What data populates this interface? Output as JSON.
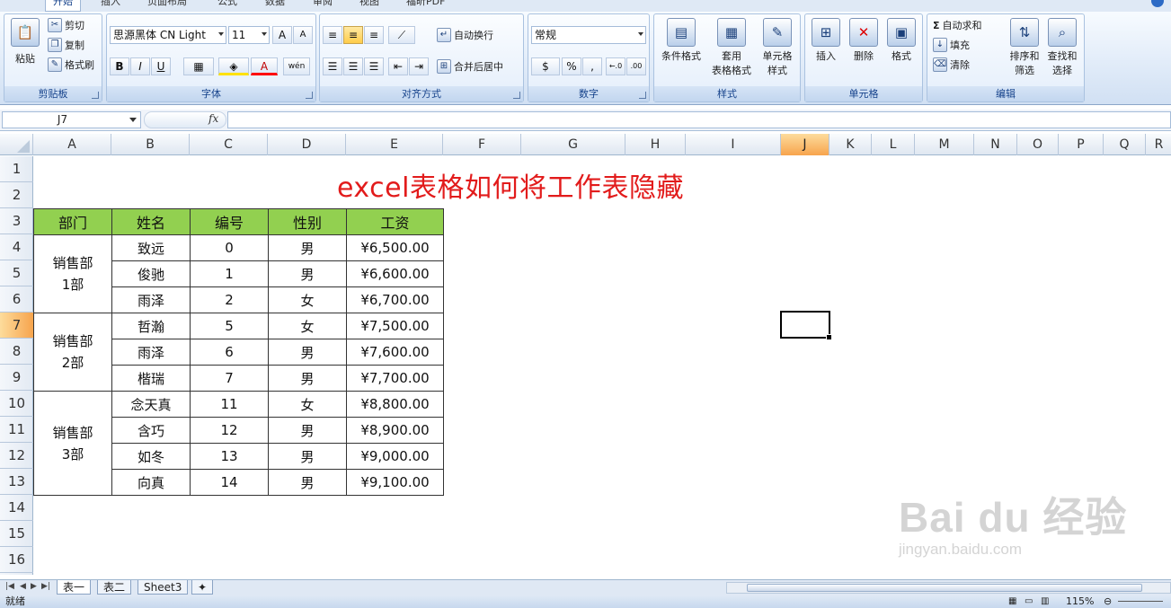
{
  "ribbon_tabs": [
    "开始",
    "插入",
    "页面布局",
    "公式",
    "数据",
    "审阅",
    "视图",
    "福昕PDF"
  ],
  "clipboard": {
    "paste": "粘贴",
    "cut": "剪切",
    "copy": "复制",
    "format_painter": "格式刷",
    "title": "剪贴板"
  },
  "font": {
    "name": "思源黑体 CN Light",
    "size": "11",
    "title": "字体",
    "bold": "B",
    "italic": "I",
    "underline": "U",
    "grow": "A",
    "shrink": "A",
    "phonetic": "wén"
  },
  "alignment": {
    "wrap": "自动换行",
    "merge": "合并后居中",
    "title": "对齐方式"
  },
  "number": {
    "format": "常规",
    "percent": "%",
    "comma": ",",
    "title": "数字",
    "inc": "←.0",
    "dec": ".00"
  },
  "styles": {
    "conditional": "条件格式",
    "table_format_1": "套用",
    "table_format_2": "表格格式",
    "cell_style_1": "单元格",
    "cell_style_2": "样式",
    "title": "样式"
  },
  "cells": {
    "insert": "插入",
    "delete": "删除",
    "format": "格式",
    "title": "单元格"
  },
  "editing": {
    "autosum": "自动求和",
    "fill": "填充",
    "clear": "清除",
    "sort_1": "排序和",
    "sort_2": "筛选",
    "find_1": "查找和",
    "find_2": "选择",
    "title": "编辑"
  },
  "namebox": "J7",
  "fx": "fx",
  "columns": [
    "A",
    "B",
    "C",
    "D",
    "E",
    "F",
    "G",
    "H",
    "I",
    "J",
    "K",
    "L",
    "M",
    "N",
    "O",
    "P",
    "Q",
    "R"
  ],
  "rows": [
    "1",
    "2",
    "3",
    "4",
    "5",
    "6",
    "7",
    "8",
    "9",
    "10",
    "11",
    "12",
    "13",
    "14",
    "15",
    "16"
  ],
  "sheet_title": "excel表格如何将工作表隐藏",
  "table": {
    "headers": [
      "部门",
      "姓名",
      "编号",
      "性别",
      "工资"
    ],
    "groups": [
      {
        "dept_1": "销售部",
        "dept_2": "1部",
        "rows": [
          [
            "致远",
            "0",
            "男",
            "¥6,500.00"
          ],
          [
            "俊驰",
            "1",
            "男",
            "¥6,600.00"
          ],
          [
            "雨泽",
            "2",
            "女",
            "¥6,700.00"
          ]
        ]
      },
      {
        "dept_1": "销售部",
        "dept_2": "2部",
        "rows": [
          [
            "哲瀚",
            "5",
            "女",
            "¥7,500.00"
          ],
          [
            "雨泽",
            "6",
            "男",
            "¥7,600.00"
          ],
          [
            "楷瑞",
            "7",
            "男",
            "¥7,700.00"
          ]
        ]
      },
      {
        "dept_1": "销售部",
        "dept_2": "3部",
        "rows": [
          [
            "念天真",
            "11",
            "女",
            "¥8,800.00"
          ],
          [
            "含巧",
            "12",
            "男",
            "¥8,900.00"
          ],
          [
            "如冬",
            "13",
            "男",
            "¥9,000.00"
          ],
          [
            "向真",
            "14",
            "男",
            "¥9,100.00"
          ]
        ]
      }
    ]
  },
  "sheet_tabs": [
    "表一",
    "表二",
    "Sheet3"
  ],
  "status": {
    "ready": "就绪",
    "zoom": "115%"
  },
  "watermark": {
    "brand": "Bai du 经验",
    "url": "jingyan.baidu.com"
  }
}
